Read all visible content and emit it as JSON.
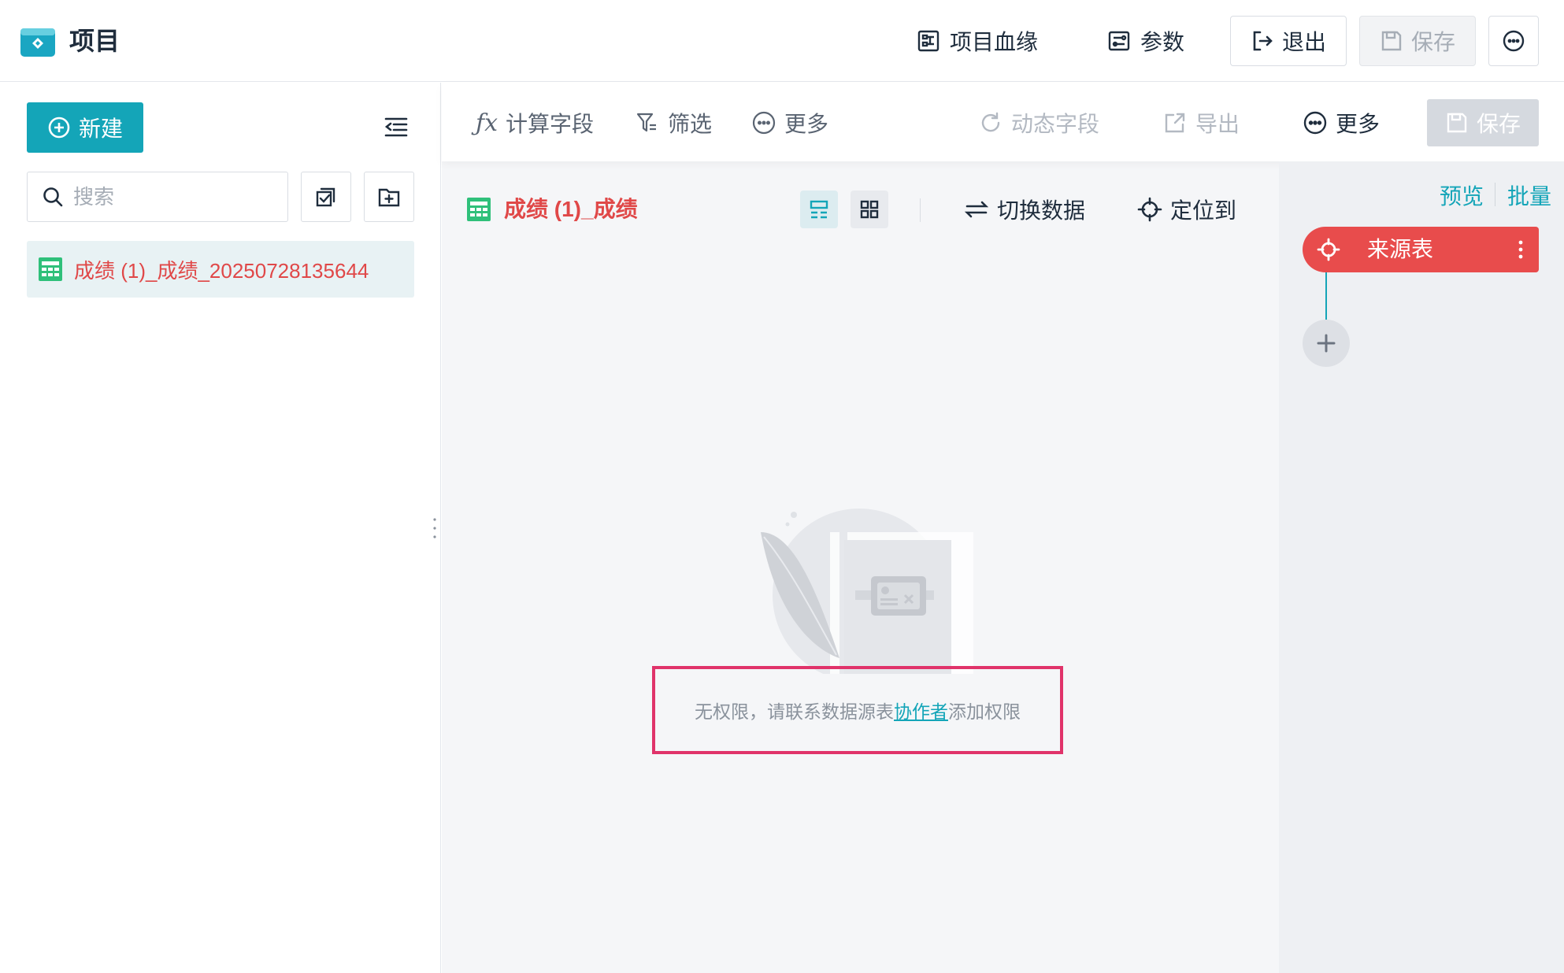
{
  "header": {
    "title": "项目",
    "lineage_label": "项目血缘",
    "params_label": "参数",
    "exit_label": "退出",
    "save_label": "保存"
  },
  "sidebar": {
    "new_label": "新建",
    "search_placeholder": "搜索",
    "items": [
      {
        "label": "成绩 (1)_成绩_20250728135644"
      }
    ]
  },
  "toolbar": {
    "calc_field_label": "计算字段",
    "filter_label": "筛选",
    "more_left_label": "更多",
    "dynamic_field_label": "动态字段",
    "export_label": "导出",
    "more_right_label": "更多",
    "save_label": "保存"
  },
  "dataset": {
    "title": "成绩 (1)_成绩",
    "switch_data_label": "切换数据",
    "locate_label": "定位到"
  },
  "empty_state": {
    "message_prefix": "无权限，请联系数据源表",
    "link_text": "协作者",
    "message_suffix": "添加权限"
  },
  "flow": {
    "preview_label": "预览",
    "batch_label": "批量",
    "source_node_label": "来源表"
  },
  "colors": {
    "brand": "#14a5b8",
    "error_red": "#e84c4c",
    "highlight_border": "#e0336a"
  }
}
